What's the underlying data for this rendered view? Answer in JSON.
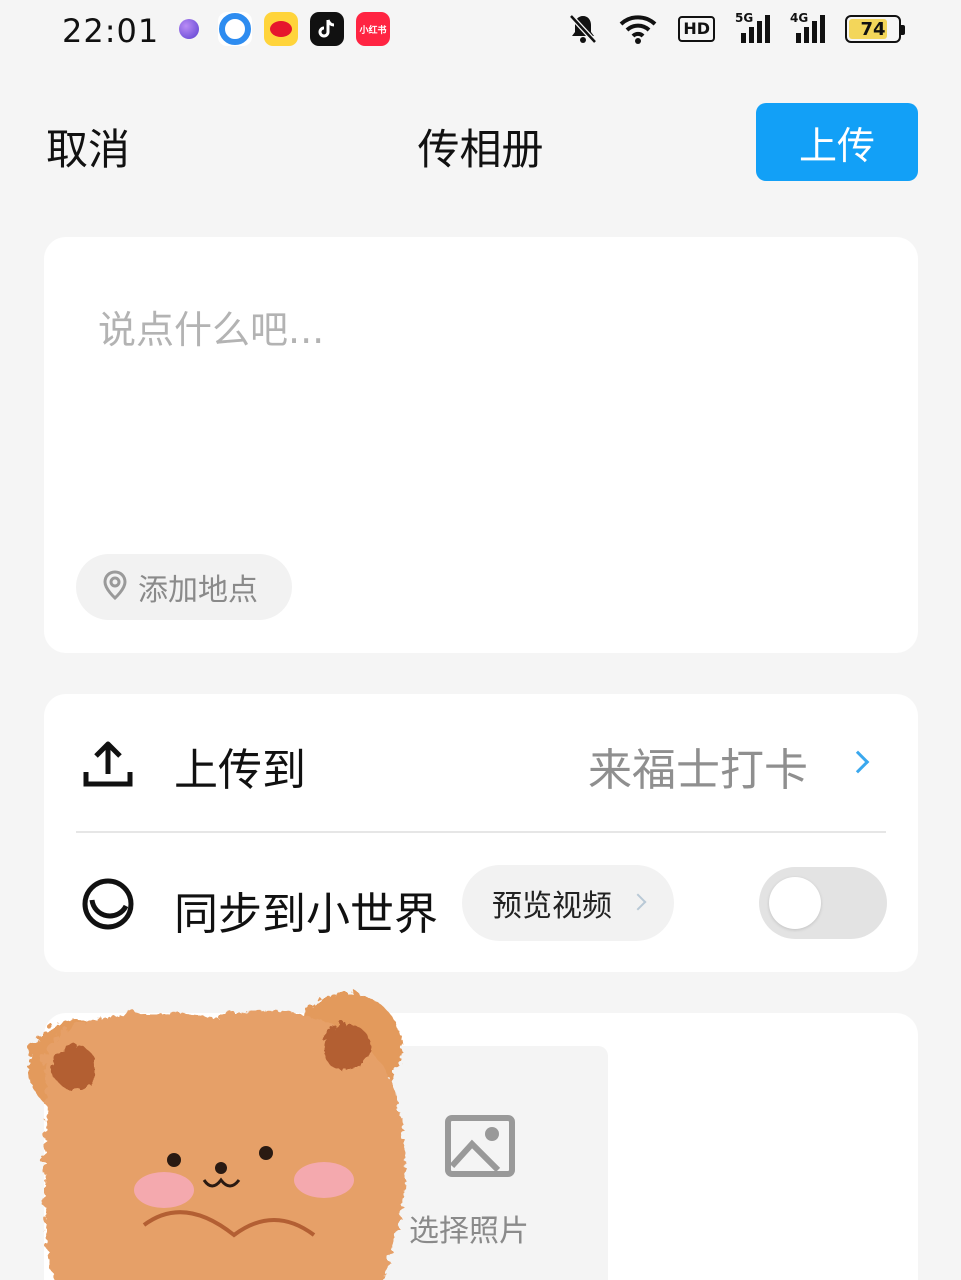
{
  "status_bar": {
    "time": "22:01",
    "notification_icons": [
      "app-icon",
      "qq-browser-icon",
      "weibo-icon",
      "douyin-icon",
      "xiaohongshu-icon"
    ],
    "xiaohongshu_label": "小红书",
    "hd_label": "HD",
    "signal_1_label": "5G",
    "signal_2_label": "4G",
    "battery": "74"
  },
  "header": {
    "cancel_label": "取消",
    "title": "传相册",
    "upload_label": "上传"
  },
  "compose": {
    "placeholder": "说点什么吧...",
    "location_label": "添加地点"
  },
  "settings": {
    "upload_to_label": "上传到",
    "upload_to_value": "来福士打卡",
    "sync_label": "同步到小世界",
    "preview_label": "预览视频",
    "sync_enabled": false
  },
  "photos": {
    "select_label": "选择照片"
  },
  "colors": {
    "accent": "#12a0f7",
    "background": "#f5f5f5",
    "card": "#ffffff",
    "placeholder": "#b3b3b3",
    "secondary_text": "#8f8f8f",
    "chevron": "#3aa8ee"
  }
}
